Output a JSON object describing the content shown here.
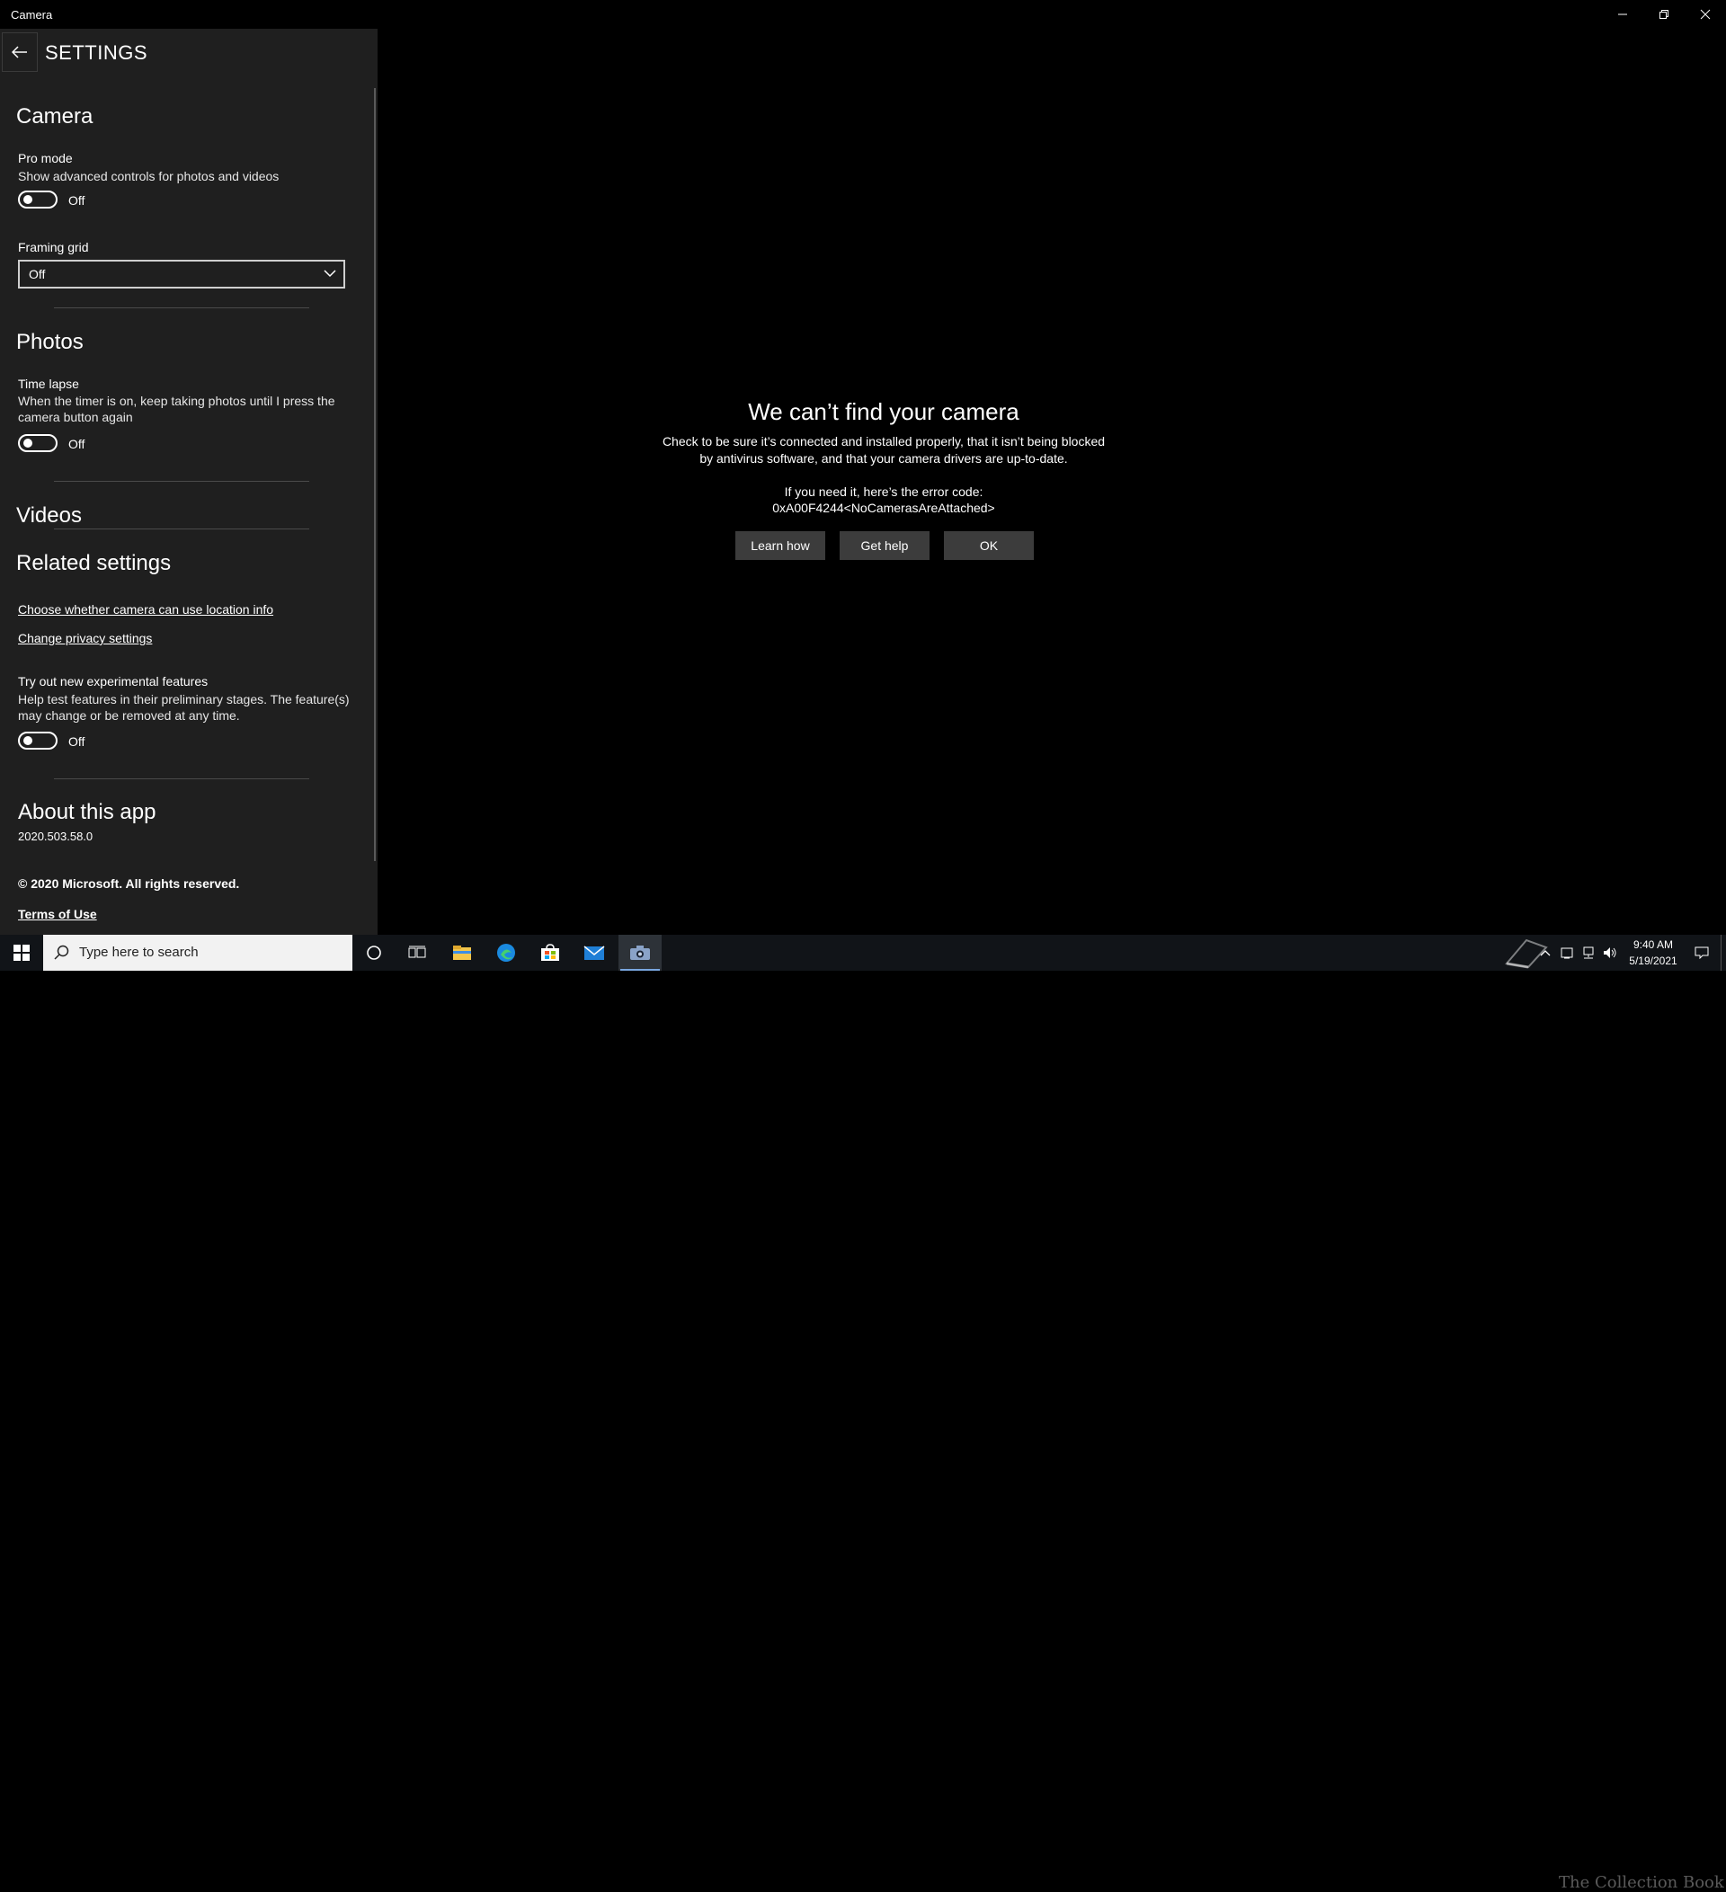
{
  "window": {
    "title": "Camera"
  },
  "settings": {
    "title": "SETTINGS",
    "camera": {
      "heading": "Camera",
      "pro_mode": {
        "label": "Pro mode",
        "desc": "Show advanced controls for photos and videos",
        "state": "Off"
      },
      "framing_grid": {
        "label": "Framing grid",
        "value": "Off"
      }
    },
    "photos": {
      "heading": "Photos",
      "time_lapse": {
        "label": "Time lapse",
        "desc": "When the timer is on, keep taking photos until I press the camera button again",
        "state": "Off"
      }
    },
    "videos": {
      "heading": "Videos"
    },
    "related": {
      "heading": "Related settings",
      "links": [
        "Choose whether camera can use location info",
        "Change privacy settings"
      ]
    },
    "experimental": {
      "label": "Try out new experimental features",
      "desc": "Help test features in their preliminary stages. The feature(s) may change or be removed at any time.",
      "state": "Off"
    },
    "about": {
      "heading": "About this app",
      "version": "2020.503.58.0",
      "copyright": "© 2020 Microsoft. All rights reserved.",
      "terms": "Terms of Use"
    }
  },
  "error": {
    "title": "We can’t find your camera",
    "line1": "Check to be sure it’s connected and installed properly, that it isn’t being blocked",
    "line2": "by antivirus software, and that your camera drivers are up-to-date.",
    "code_label": "If you need it, here’s the error code:",
    "code": "0xA00F4244<NoCamerasAreAttached>",
    "buttons": {
      "learn": "Learn how",
      "help": "Get help",
      "ok": "OK"
    }
  },
  "taskbar": {
    "search_placeholder": "Type here to search",
    "time": "9:40 AM",
    "date": "5/19/2021",
    "watermark": "The Collection Book",
    "icons": [
      "windows-start-icon",
      "search-icon",
      "cortana-icon",
      "task-view-icon",
      "file-explorer-icon",
      "edge-icon",
      "store-icon",
      "mail-icon",
      "camera-icon"
    ]
  }
}
